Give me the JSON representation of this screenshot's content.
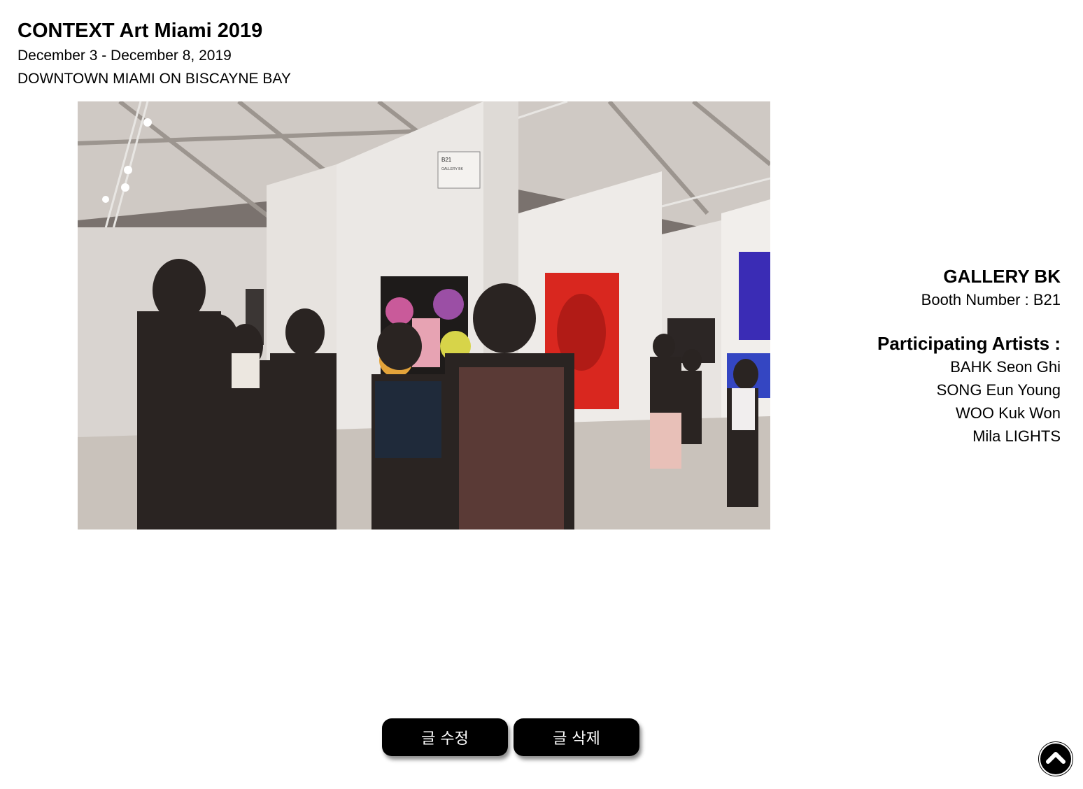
{
  "event": {
    "title": "CONTEXT Art Miami 2019",
    "dates": "December 3 - December 8, 2019",
    "venue": "DOWNTOWN MIAMI ON BISCAYNE BAY"
  },
  "gallery": {
    "name": "GALLERY BK",
    "booth": "Booth Number : B21",
    "artists_heading": "Participating Artists :",
    "artists": [
      "BAHK Seon Ghi",
      "SONG Eun Young",
      "WOO Kuk Won",
      "Mila LIGHTS"
    ]
  },
  "photo": {
    "booth_sign": "B21",
    "booth_sign_sub": "GALLERY BK"
  },
  "actions": {
    "edit_label": "글 수정",
    "delete_label": "글 삭제"
  },
  "icons": {
    "scroll_top": "chevron-up-icon"
  }
}
